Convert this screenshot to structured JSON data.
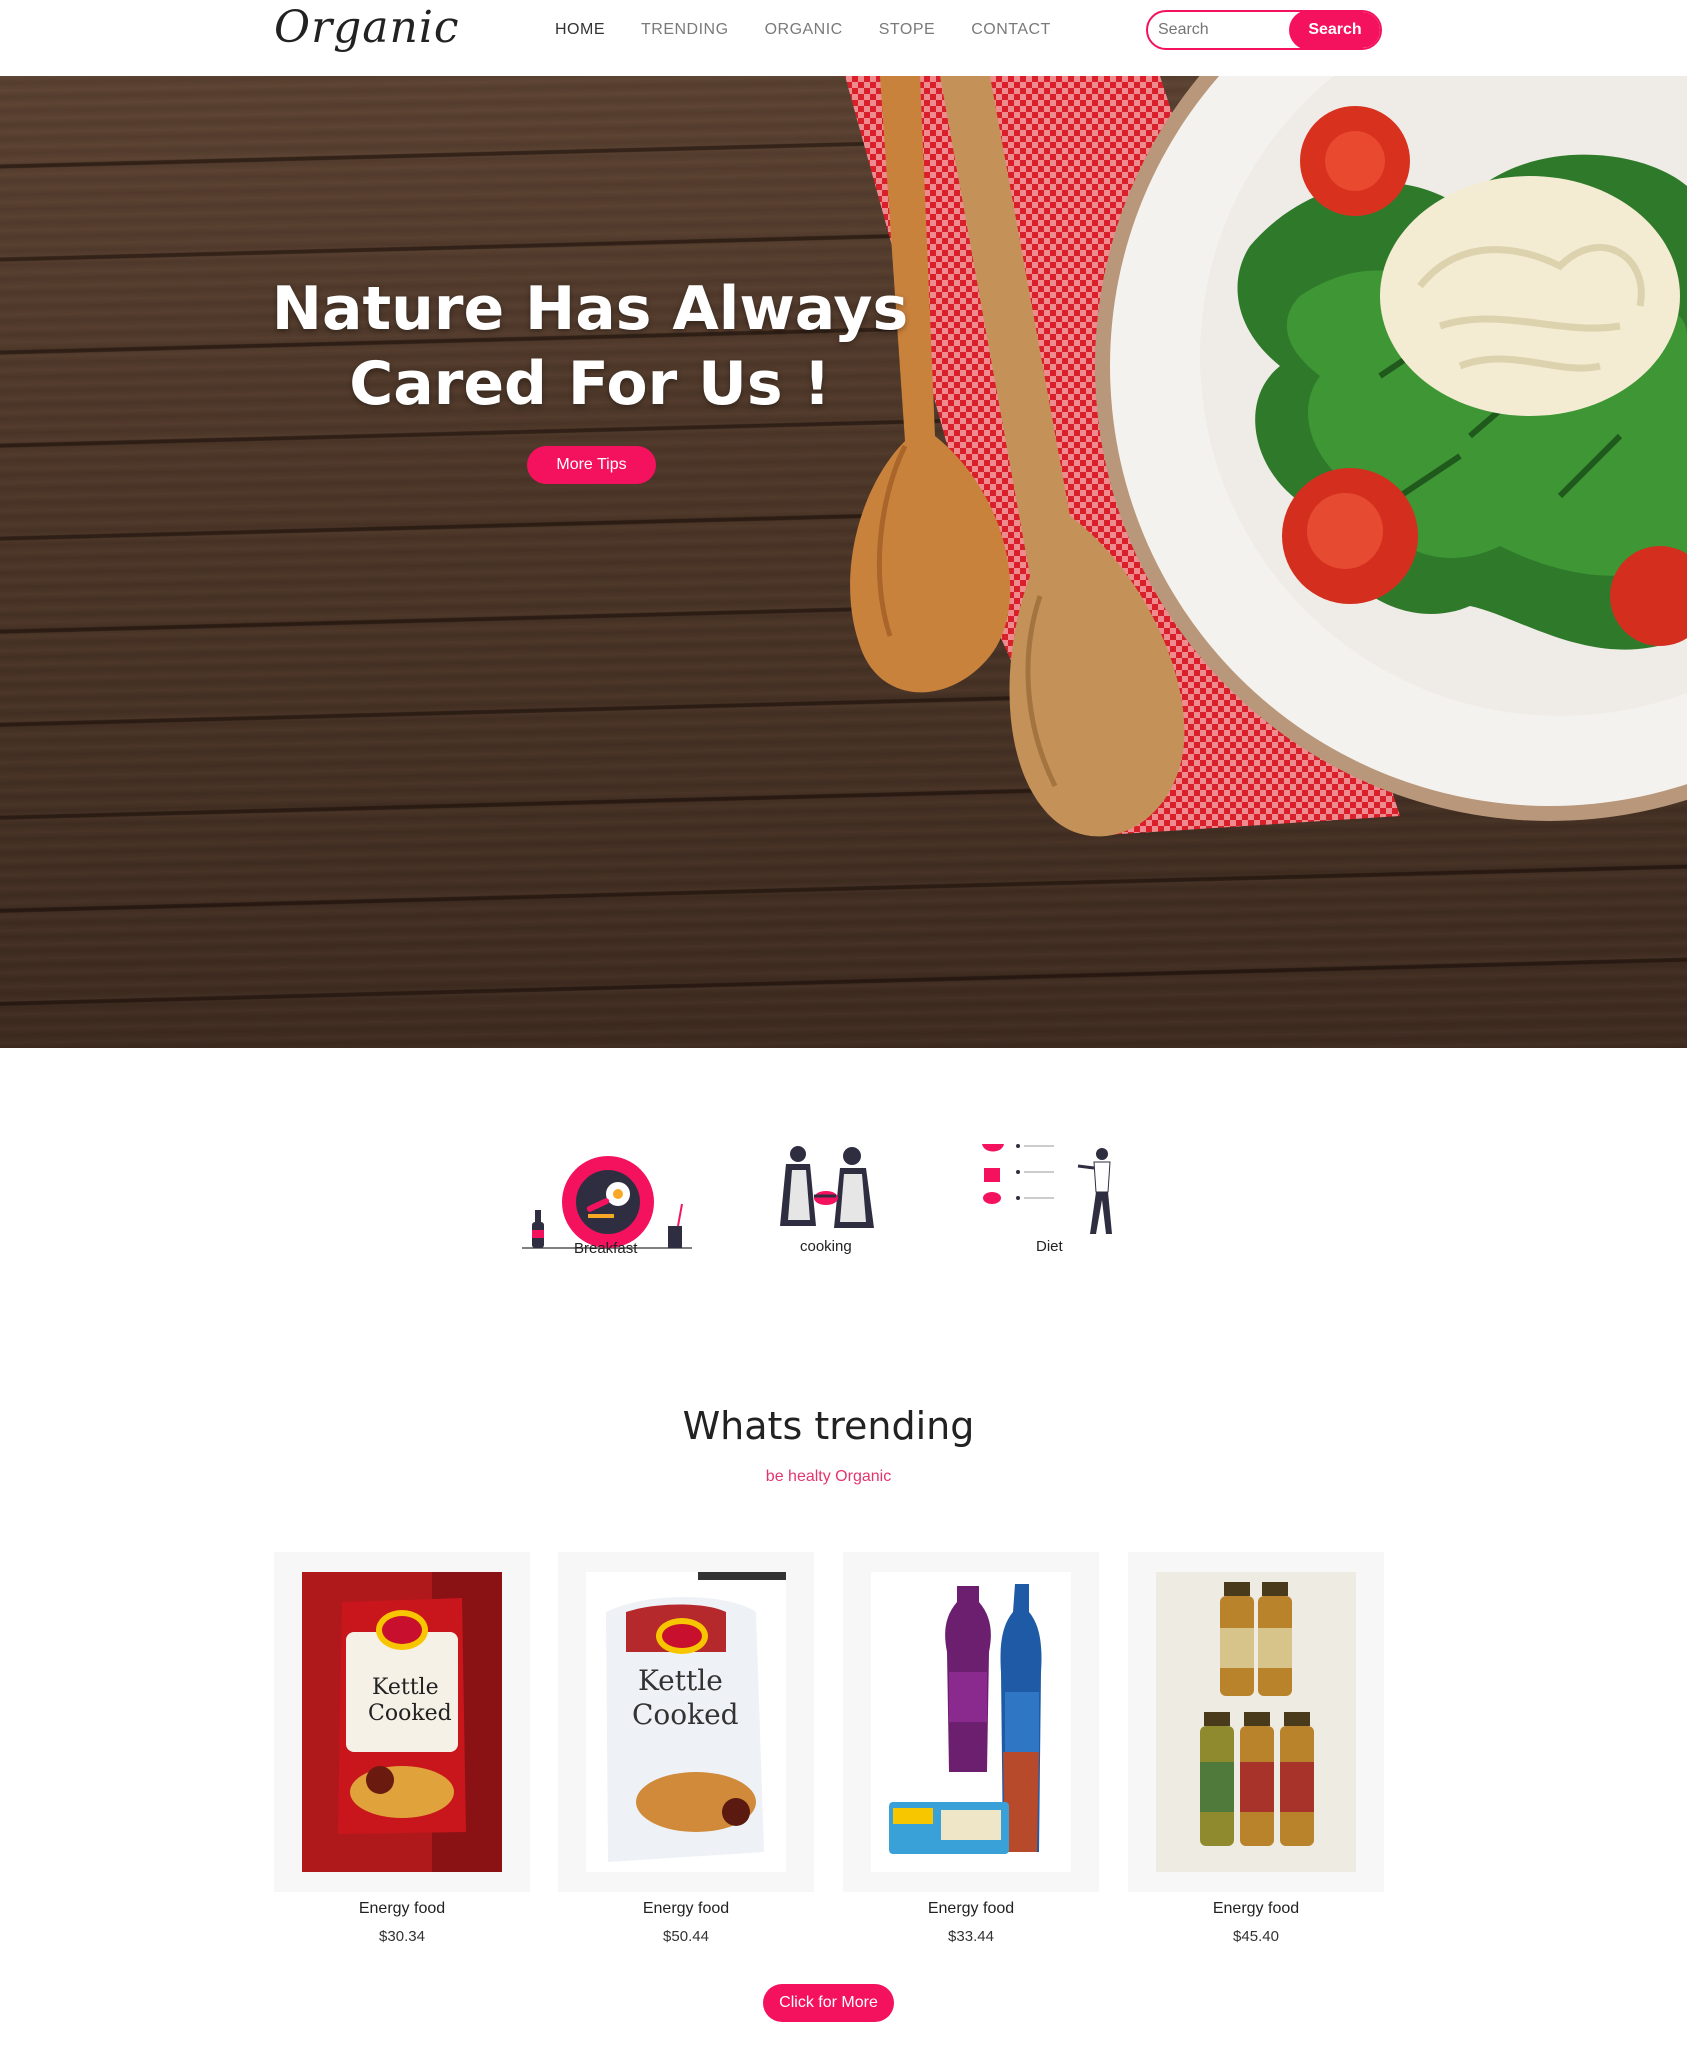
{
  "nav": {
    "logo": "Organic",
    "links": [
      "HOME",
      "TRENDING",
      "ORGANIC",
      "STOPE",
      "CONTACT"
    ],
    "search_placeholder": "Search",
    "search_button": "Search"
  },
  "hero": {
    "title_line1": "Nature Has Always",
    "title_line2": "Cared For Us !",
    "button": "More Tips"
  },
  "categories": [
    {
      "label": "Breakfast",
      "icon": "breakfast-plate-icon"
    },
    {
      "label": "cooking",
      "icon": "cooking-people-icon"
    },
    {
      "label": "Diet",
      "icon": "diet-checklist-icon"
    }
  ],
  "trending": {
    "title": "Whats trending",
    "subtitle": "be healty Organic",
    "products": [
      {
        "name": "Energy food",
        "price": "$30.34",
        "image": "kettle-chips-red-bag"
      },
      {
        "name": "Energy food",
        "price": "$50.44",
        "image": "kettle-chips-white-bag"
      },
      {
        "name": "Energy food",
        "price": "$33.44",
        "image": "powerbar-products"
      },
      {
        "name": "Energy food",
        "price": "$45.40",
        "image": "peanut-butter-jars"
      }
    ],
    "more_button": "Click for More"
  },
  "colors": {
    "accent": "#f4125f",
    "subtitle": "#e2356e",
    "wood": "#4b3527"
  }
}
